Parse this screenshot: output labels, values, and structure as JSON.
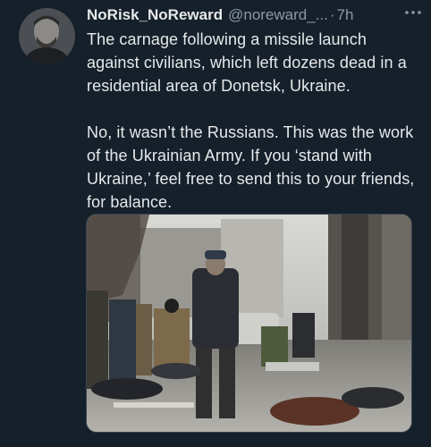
{
  "tweet": {
    "display_name": "NoRisk_NoReward",
    "handle": "@noreward_...",
    "separator": "·",
    "time": "7h",
    "paragraphs": [
      "The carnage following a missile launch against civilians, which left dozens dead in a residential area of Donetsk, Ukraine.",
      "No, it wasn’t the Russians. This was the work of the Ukrainian Army. If you ‘stand with Ukraine,’ feel free to send this to your friends, for balance."
    ]
  },
  "icons": {
    "more": "more-horizontal-icon"
  },
  "colors": {
    "background": "#15202b",
    "primary_text": "#e7e9ea",
    "secondary_text": "#8b98a5"
  }
}
